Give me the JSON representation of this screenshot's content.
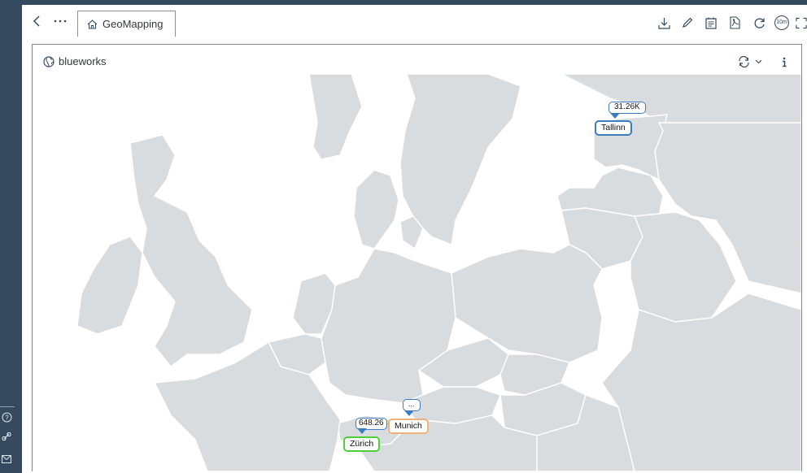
{
  "toolbar": {
    "tab_label": "GeoMapping",
    "refresh_interval": "10m"
  },
  "widget": {
    "title": "blueworks"
  },
  "map": {
    "markers": [
      {
        "city": "Tallinn",
        "value": "31.26K"
      },
      {
        "city": "Munich",
        "value": "..."
      },
      {
        "city": "Zürich",
        "value": "648.26"
      }
    ]
  },
  "colors": {
    "shell": "#354a5f",
    "land": "#d9dcdf",
    "border": "#ffffff",
    "tallinn_outline": "#3b7dc3",
    "munich_outline": "#f0b27a",
    "zurich_outline": "#4cd137"
  }
}
